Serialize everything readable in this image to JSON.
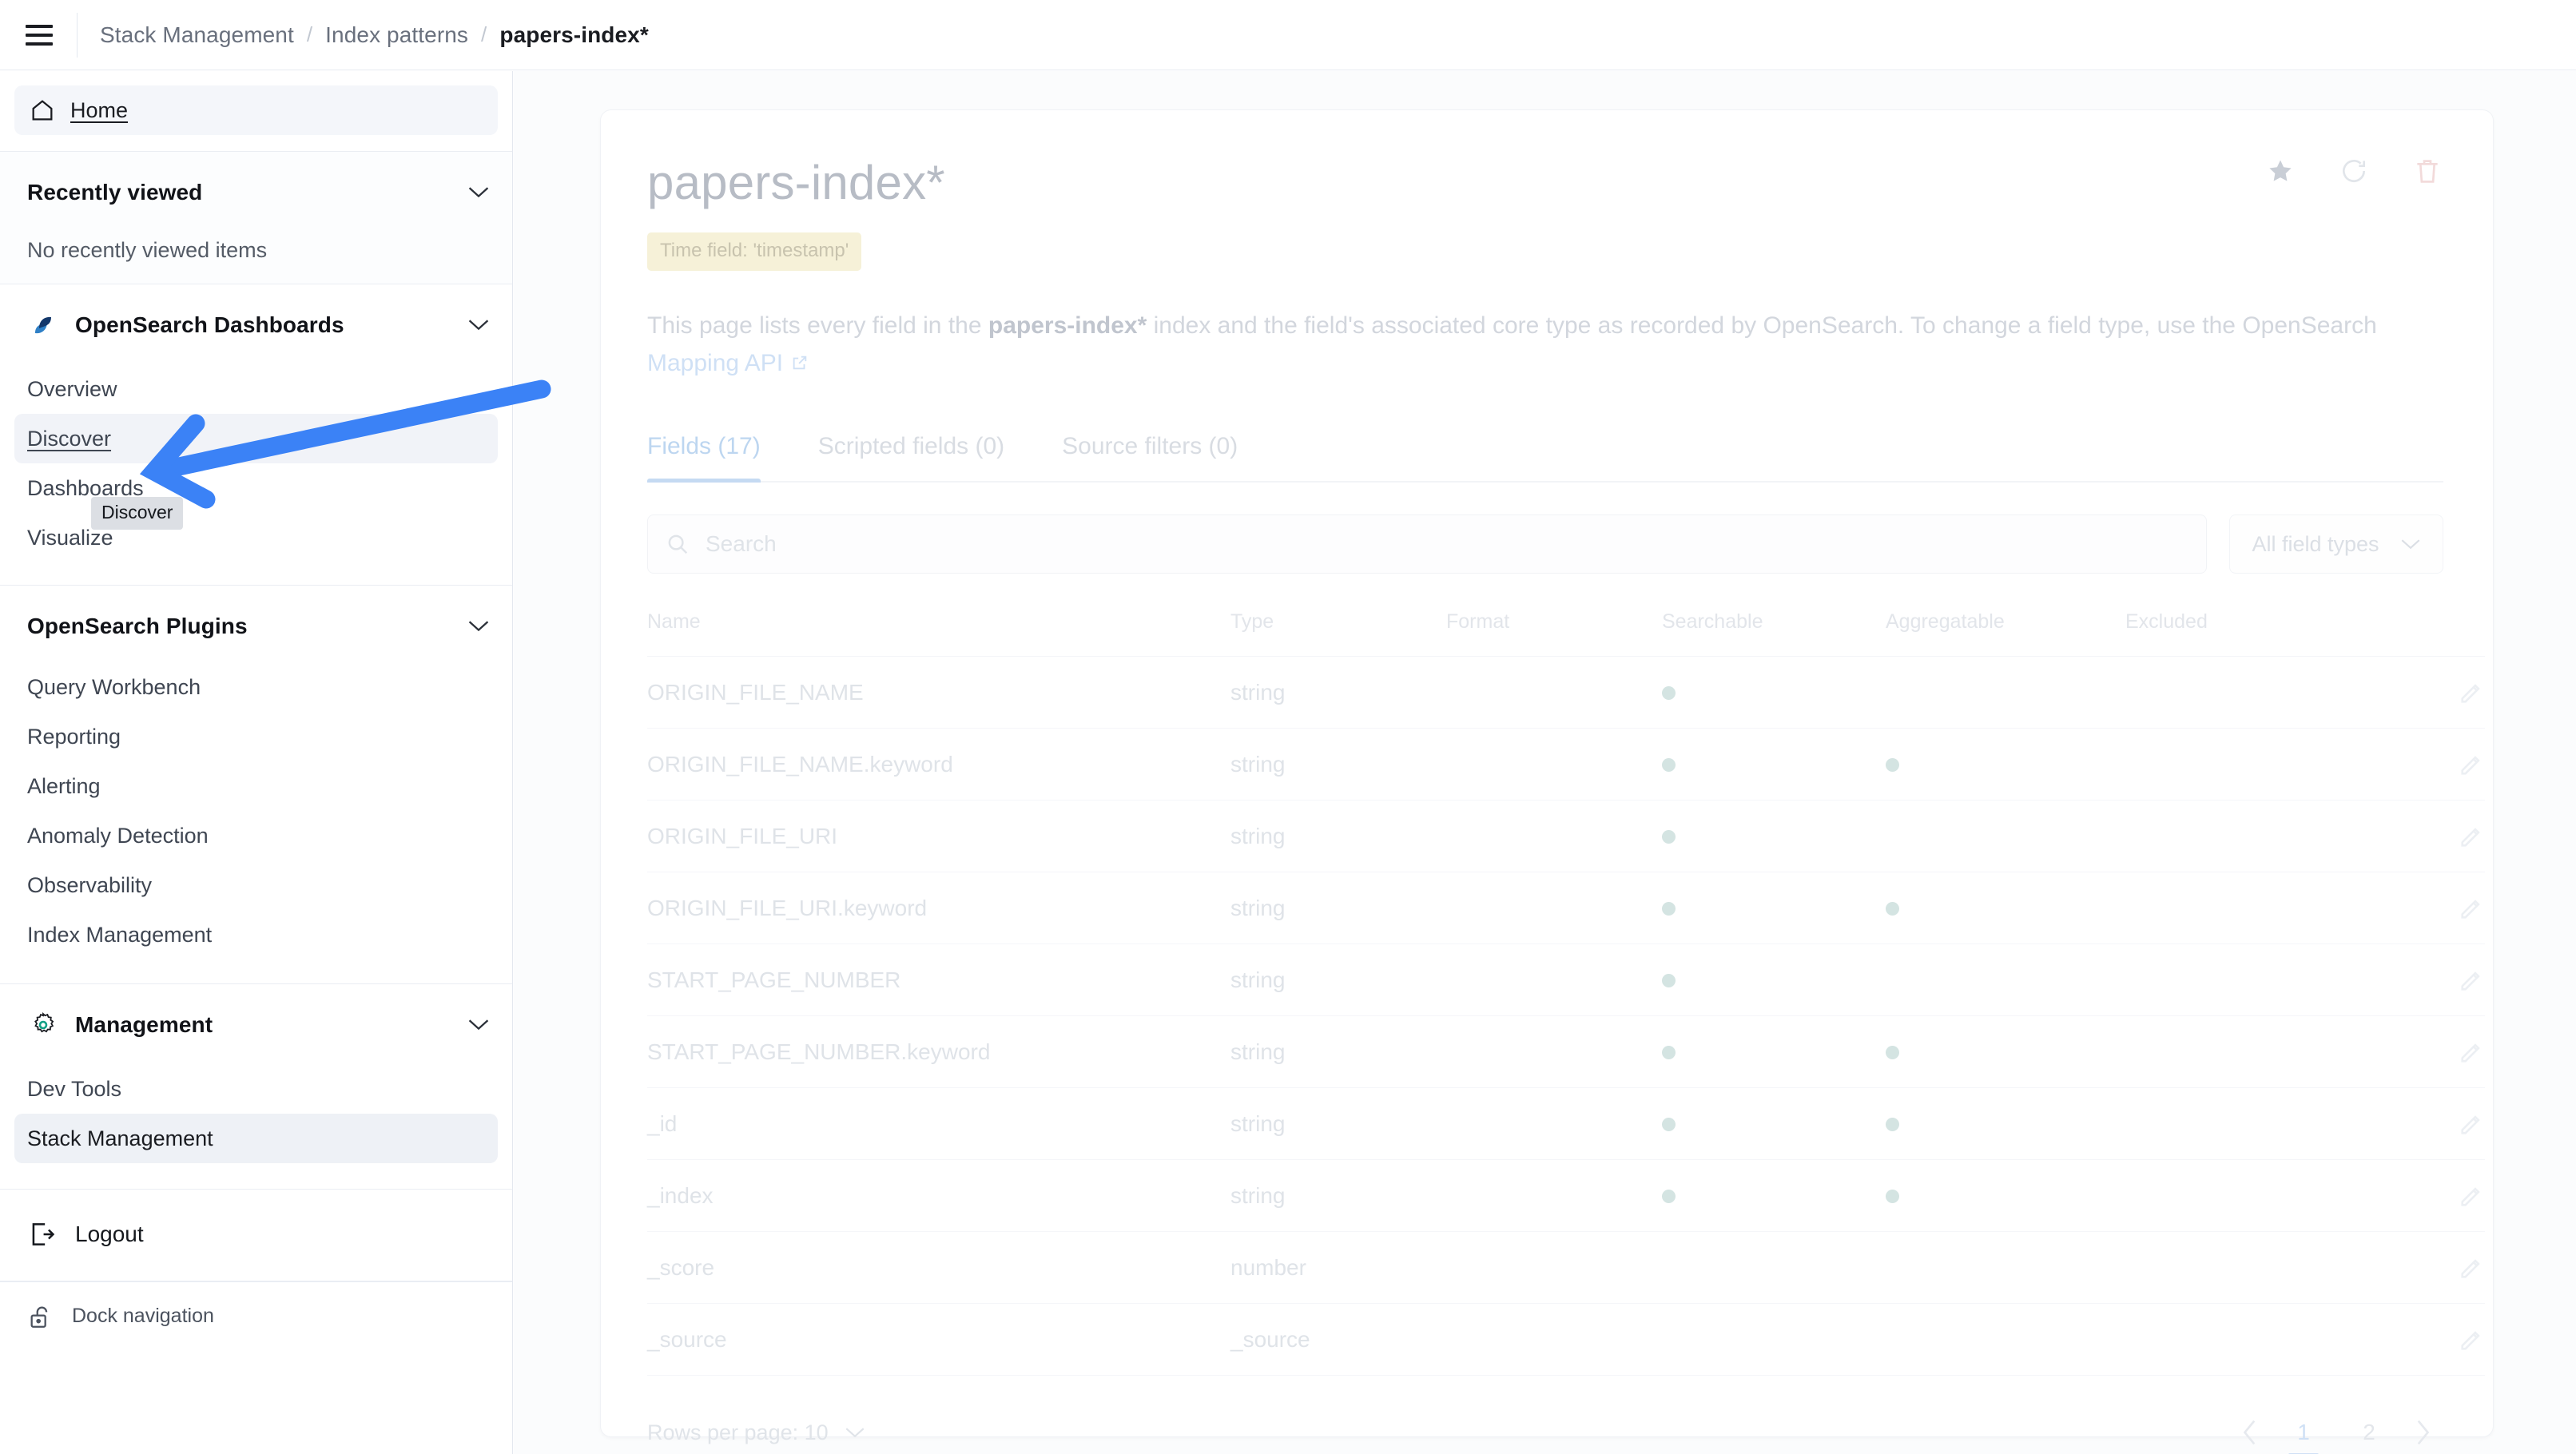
{
  "topbar": {
    "menu_icon": "hamburger-icon",
    "breadcrumb": [
      {
        "label": "Stack Management",
        "active": false
      },
      {
        "label": "Index patterns",
        "active": false
      },
      {
        "label": "papers-index*",
        "active": true
      }
    ],
    "separator": "/"
  },
  "sidebar": {
    "home": {
      "label": "Home",
      "icon": "home-icon"
    },
    "recently_viewed": {
      "title": "Recently viewed",
      "empty_text": "No recently viewed items",
      "chevron": "chevron-down-icon"
    },
    "dashboards_group": {
      "title": "OpenSearch Dashboards",
      "icon": "opensearch-logo-icon",
      "chevron": "chevron-down-icon",
      "items": [
        {
          "label": "Overview",
          "state": "normal"
        },
        {
          "label": "Discover",
          "state": "active-underlined"
        },
        {
          "label": "Dashboards",
          "state": "normal"
        },
        {
          "label": "Visualize",
          "state": "normal"
        }
      ]
    },
    "plugins_group": {
      "title": "OpenSearch Plugins",
      "chevron": "chevron-down-icon",
      "items": [
        {
          "label": "Query Workbench"
        },
        {
          "label": "Reporting"
        },
        {
          "label": "Alerting"
        },
        {
          "label": "Anomaly Detection"
        },
        {
          "label": "Observability"
        },
        {
          "label": "Index Management"
        }
      ]
    },
    "management_group": {
      "title": "Management",
      "icon": "gear-icon",
      "chevron": "chevron-down-icon",
      "items": [
        {
          "label": "Dev Tools",
          "state": "normal"
        },
        {
          "label": "Stack Management",
          "state": "selected"
        }
      ]
    },
    "logout": {
      "label": "Logout",
      "icon": "logout-icon"
    },
    "dock": {
      "label": "Dock navigation",
      "icon": "unlock-icon"
    },
    "tooltip": {
      "text": "Discover"
    }
  },
  "main": {
    "title": "papers-index*",
    "time_field_badge": "Time field: 'timestamp'",
    "description": {
      "part1": "This page lists every field in the ",
      "bold1": "papers-index*",
      "part2": " index and the field's associated core type as recorded by OpenSearch. To change a field type, use the OpenSearch ",
      "link": "Mapping API",
      "link_icon": "external-link-icon"
    },
    "header_actions": [
      {
        "name": "favorite-star-button",
        "icon": "star-icon"
      },
      {
        "name": "refresh-button",
        "icon": "refresh-icon"
      },
      {
        "name": "delete-button",
        "icon": "trash-icon"
      }
    ],
    "tabs": [
      {
        "label": "Fields (17)",
        "active": true
      },
      {
        "label": "Scripted fields (0)",
        "active": false
      },
      {
        "label": "Source filters (0)",
        "active": false
      }
    ],
    "search": {
      "placeholder": "Search",
      "value": "",
      "icon": "search-icon"
    },
    "field_types_filter": {
      "label": "All field types",
      "chevron": "chevron-down-icon"
    },
    "table": {
      "columns": [
        "Name",
        "Type",
        "Format",
        "Searchable",
        "Aggregatable",
        "Excluded"
      ],
      "rows": [
        {
          "name": "ORIGIN_FILE_NAME",
          "type": "string",
          "format": "",
          "searchable": true,
          "aggregatable": false,
          "excluded": false
        },
        {
          "name": "ORIGIN_FILE_NAME.keyword",
          "type": "string",
          "format": "",
          "searchable": true,
          "aggregatable": true,
          "excluded": false
        },
        {
          "name": "ORIGIN_FILE_URI",
          "type": "string",
          "format": "",
          "searchable": true,
          "aggregatable": false,
          "excluded": false
        },
        {
          "name": "ORIGIN_FILE_URI.keyword",
          "type": "string",
          "format": "",
          "searchable": true,
          "aggregatable": true,
          "excluded": false
        },
        {
          "name": "START_PAGE_NUMBER",
          "type": "string",
          "format": "",
          "searchable": true,
          "aggregatable": false,
          "excluded": false
        },
        {
          "name": "START_PAGE_NUMBER.keyword",
          "type": "string",
          "format": "",
          "searchable": true,
          "aggregatable": true,
          "excluded": false
        },
        {
          "name": "_id",
          "type": "string",
          "format": "",
          "searchable": true,
          "aggregatable": true,
          "excluded": false
        },
        {
          "name": "_index",
          "type": "string",
          "format": "",
          "searchable": true,
          "aggregatable": true,
          "excluded": false
        },
        {
          "name": "_score",
          "type": "number",
          "format": "",
          "searchable": false,
          "aggregatable": false,
          "excluded": false
        },
        {
          "name": "_source",
          "type": "_source",
          "format": "",
          "searchable": false,
          "aggregatable": false,
          "excluded": false
        }
      ],
      "row_action_icon": "pencil-icon"
    },
    "footer": {
      "rows_per_page_label": "Rows per page: 10",
      "rows_per_page_chevron": "chevron-down-icon",
      "prev_icon": "chevron-left-icon",
      "next_icon": "chevron-right-icon",
      "pages": [
        {
          "label": "1",
          "active": true
        },
        {
          "label": "2",
          "active": false
        }
      ]
    }
  },
  "annotation": {
    "arrow_color": "#3b82f6",
    "description": "blue arrow pointing to Discover nav item"
  }
}
